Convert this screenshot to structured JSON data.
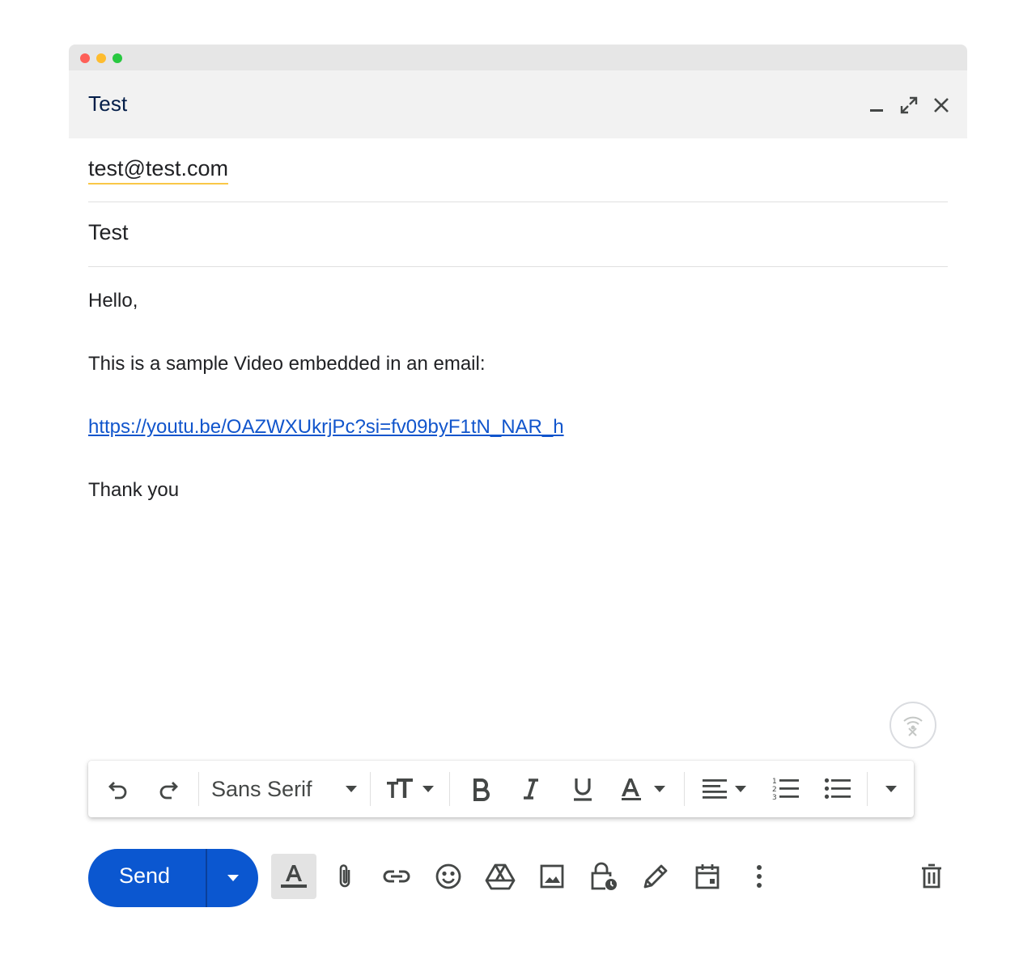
{
  "compose": {
    "title": "Test",
    "to": "test@test.com",
    "subject": "Test",
    "body": {
      "greeting": "Hello,",
      "line": "This is a sample Video embedded in an email:",
      "link": "https://youtu.be/OAZWXUkrjPc?si=fv09byF1tN_NAR_h",
      "closing": "Thank you"
    }
  },
  "format_bar": {
    "font": "Sans Serif"
  },
  "actions": {
    "send_label": "Send"
  },
  "colors": {
    "send": "#0b57d0",
    "link": "#1155cc",
    "header_bg": "#f2f2f2",
    "chip_underline": "#f9c748"
  }
}
